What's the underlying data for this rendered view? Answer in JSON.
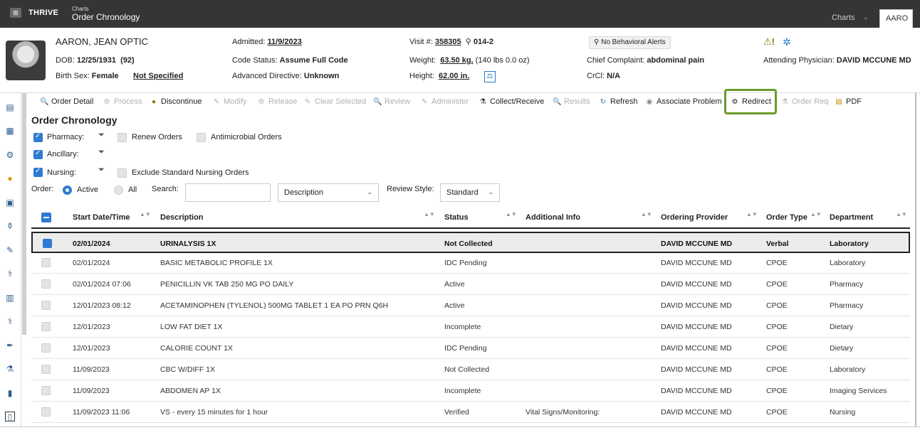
{
  "topbar": {
    "logo_glyph": "⊞",
    "app_name": "THRIVE",
    "crumb_parent": "Charts",
    "crumb_title": "Order Chronology",
    "charts_tab": "Charts",
    "patient_tab": "AARO"
  },
  "patient": {
    "name": "AARON, JEAN OPTIC",
    "dob_label": "DOB:",
    "dob_value": "12/25/1931",
    "age": "(92)",
    "sex_label": "Birth Sex:",
    "sex_value": "Female",
    "not_specified": "Not Specified",
    "admitted_label": "Admitted:",
    "admitted_value": "11/9/2023",
    "code_status_label": "Code Status:",
    "code_status_value": "Assume Full Code",
    "adv_dir_label": "Advanced Directive:",
    "adv_dir_value": "Unknown",
    "visit_label": "Visit #:",
    "visit_value": "358305",
    "room_icon": "⚲",
    "room_value": "014-2",
    "weight_label": "Weight:",
    "weight_value": "63.50 kg.",
    "weight_extra": "(140 lbs 0.0 oz)",
    "height_label": "Height:",
    "height_value": "62.00 in.",
    "weight_icon": "⚖",
    "alert_pill": "No Behavioral Alerts",
    "alert_icon": "⚲",
    "warn_glyph": "⚠!",
    "gear_glyph": "✲",
    "chief_label": "Chief Complaint:",
    "chief_value": "abdominal pain",
    "crcl_label": "CrCl:",
    "crcl_value": "N/A",
    "attending_label": "Attending Physician:",
    "attending_value": "DAVID MCCUNE MD"
  },
  "rail_icons": [
    "▤",
    "▦",
    "⚙",
    "●",
    "▣",
    "⚱",
    "✎",
    "⚕",
    "▥",
    "⚕",
    "✒",
    "⚗",
    "▮",
    "▯"
  ],
  "toolbar": {
    "items": [
      {
        "label": "Order Detail",
        "glyph": "🔍",
        "enabled": true
      },
      {
        "label": "Process",
        "glyph": "⚙",
        "enabled": false
      },
      {
        "label": "Discontinue",
        "glyph": "●",
        "enabled": true
      },
      {
        "label": "Modify",
        "glyph": "✎",
        "enabled": false
      },
      {
        "label": "Release",
        "glyph": "⚙",
        "enabled": false
      },
      {
        "label": "Clear Selected",
        "glyph": "✎",
        "enabled": false
      },
      {
        "label": "Review",
        "glyph": "🔍",
        "enabled": false
      },
      {
        "label": "Administer",
        "glyph": "✎",
        "enabled": false
      },
      {
        "label": "Collect/Receive",
        "glyph": "⚗",
        "enabled": true
      },
      {
        "label": "Results",
        "glyph": "🔍",
        "enabled": false
      },
      {
        "label": "Refresh",
        "glyph": "↻",
        "enabled": true
      },
      {
        "label": "Associate Problem",
        "glyph": "◉",
        "enabled": true
      },
      {
        "label": "Redirect",
        "glyph": "⚙",
        "enabled": true
      },
      {
        "label": "Order Req",
        "glyph": "⚗",
        "enabled": false
      },
      {
        "label": "PDF",
        "glyph": "▤",
        "enabled": true
      }
    ]
  },
  "page_title": "Order Chronology",
  "filters": {
    "pharmacy": "Pharmacy:",
    "renew_orders": "Renew Orders",
    "antimicrobial": "Antimicrobial Orders",
    "ancillary": "Ancillary:",
    "nursing": "Nursing:",
    "exclude_nursing": "Exclude Standard Nursing Orders",
    "filter_glyph": "⏷",
    "order_label": "Order:",
    "active": "Active",
    "all": "All",
    "search_label": "Search:",
    "search_value": "",
    "search_field": "Description",
    "review_style_label": "Review Style:",
    "review_style_value": "Standard",
    "chevron": "⌄"
  },
  "table": {
    "headers": [
      "Start Date/Time",
      "Description",
      "Status",
      "Additional Info",
      "Ordering Provider",
      "Order Type",
      "Department"
    ],
    "sort_glyph": "▲▼",
    "rows": [
      [
        "02/01/2024",
        "URINALYSIS 1X",
        "Not Collected",
        "",
        "DAVID MCCUNE MD",
        "Verbal",
        "Laboratory"
      ],
      [
        "02/01/2024",
        "BASIC METABOLIC PROFILE 1X",
        "IDC Pending",
        "",
        "DAVID MCCUNE MD",
        "CPOE",
        "Laboratory"
      ],
      [
        "02/01/2024 07:06",
        "PENICILLIN VK TAB 250 MG PO DAILY",
        "Active",
        "",
        "DAVID MCCUNE MD",
        "CPOE",
        "Pharmacy"
      ],
      [
        "12/01/2023 08:12",
        "ACETAMINOPHEN (TYLENOL) 500MG TABLET 1 EA PO PRN Q6H",
        "Active",
        "",
        "DAVID MCCUNE MD",
        "CPOE",
        "Pharmacy"
      ],
      [
        "12/01/2023",
        "LOW FAT DIET 1X",
        "Incomplete",
        "",
        "DAVID MCCUNE MD",
        "CPOE",
        "Dietary"
      ],
      [
        "12/01/2023",
        "CALORIE COUNT 1X",
        "IDC Pending",
        "",
        "DAVID MCCUNE MD",
        "CPOE",
        "Dietary"
      ],
      [
        "11/09/2023",
        "CBC W/DIFF 1X",
        "Not Collected",
        "",
        "DAVID MCCUNE MD",
        "CPOE",
        "Laboratory"
      ],
      [
        "11/09/2023",
        "ABDOMEN AP 1X",
        "Incomplete",
        "",
        "DAVID MCCUNE MD",
        "CPOE",
        "Imaging Services"
      ],
      [
        "11/09/2023 11:06",
        "VS - every 15 minutes for 1 hour",
        "Verified",
        "Vital Signs/Monitoring:",
        "DAVID MCCUNE MD",
        "CPOE",
        "Nursing"
      ]
    ]
  }
}
